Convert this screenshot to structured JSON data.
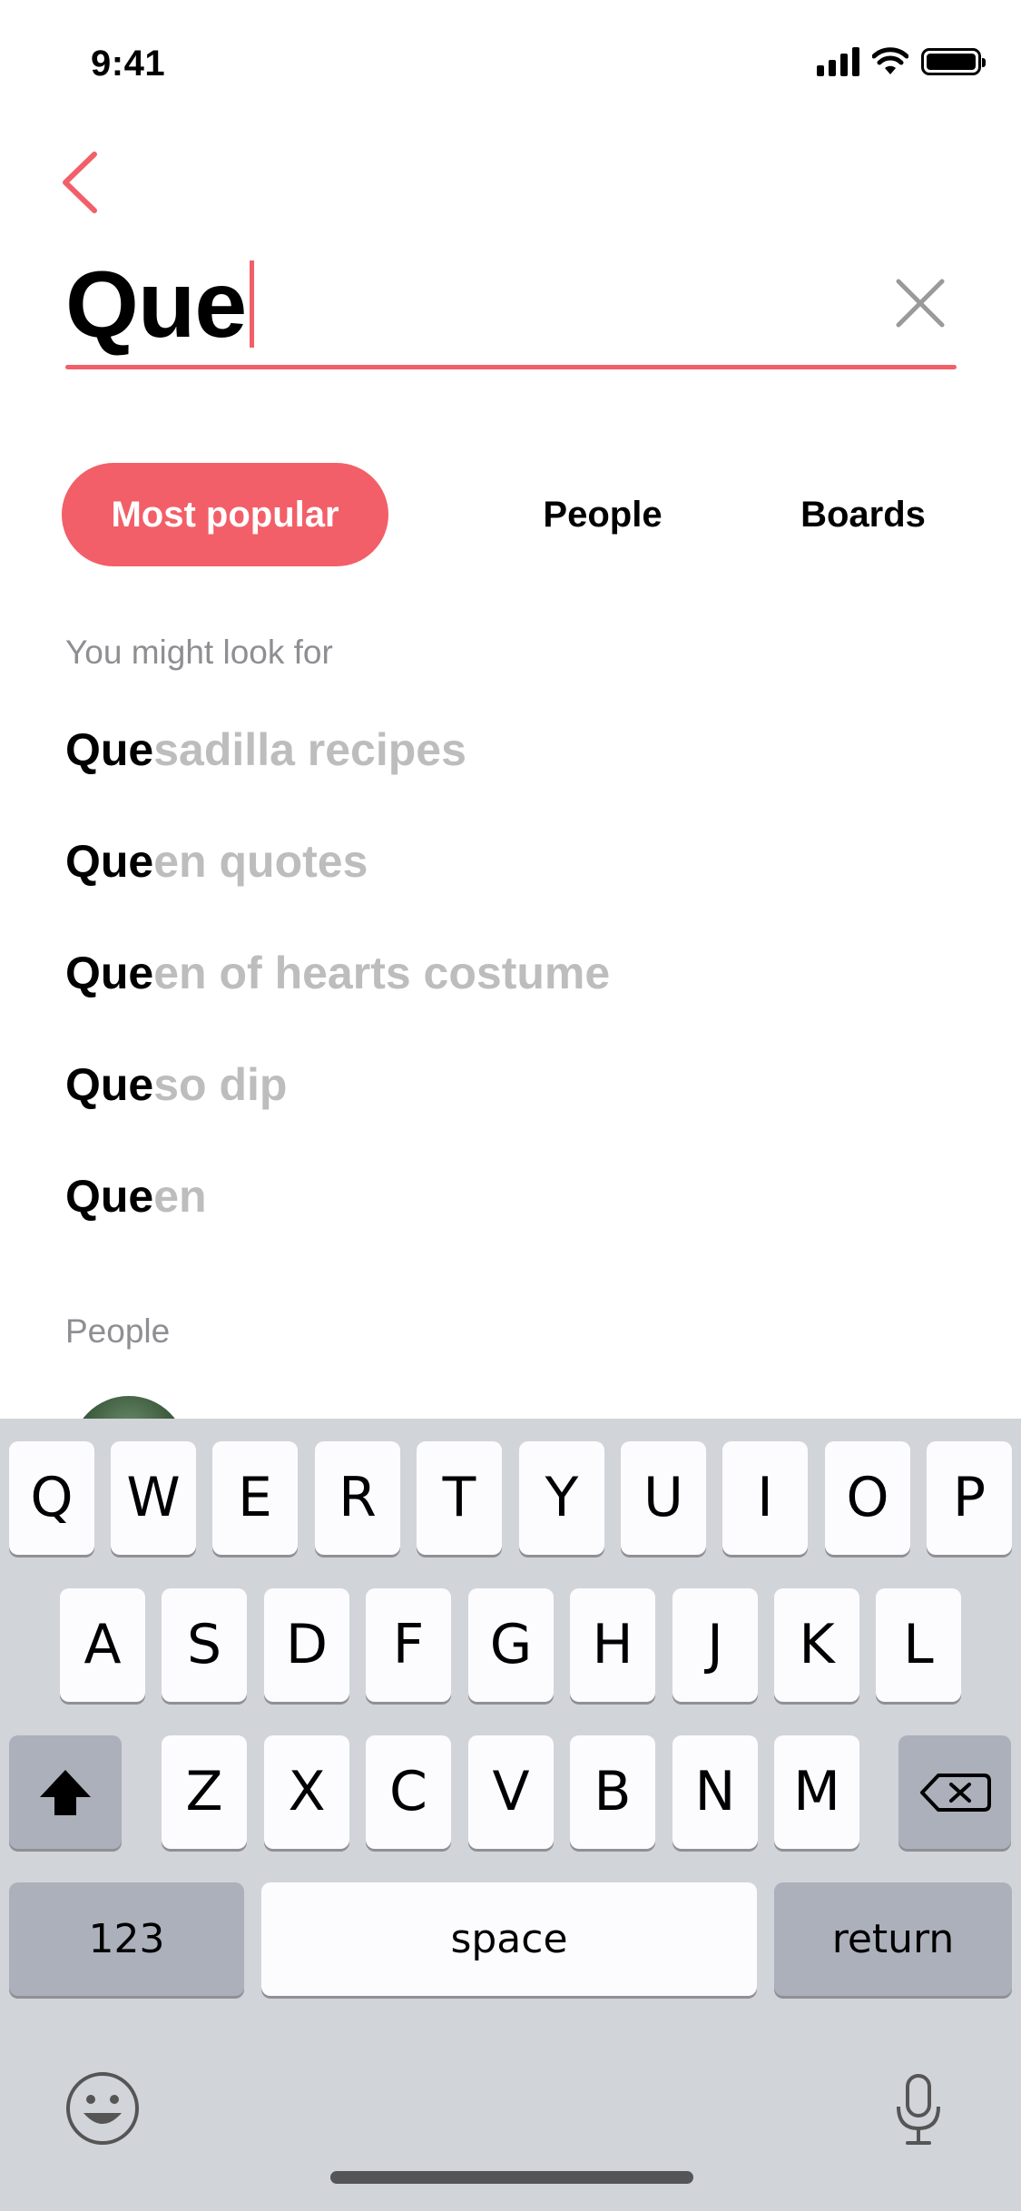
{
  "status_bar": {
    "time": "9:41"
  },
  "search": {
    "value": "Que"
  },
  "tabs": [
    {
      "label": "Most popular",
      "active": true
    },
    {
      "label": "People",
      "active": false
    },
    {
      "label": "Boards",
      "active": false
    }
  ],
  "sections": {
    "suggestions_label": "You might look for",
    "people_label": "People"
  },
  "suggestions": [
    {
      "typed": "Que",
      "rest": "sadilla recipes"
    },
    {
      "typed": "Que",
      "rest": "en quotes"
    },
    {
      "typed": "Que",
      "rest": "en of hearts costume"
    },
    {
      "typed": "Que",
      "rest": "so dip"
    },
    {
      "typed": "Que",
      "rest": "en"
    }
  ],
  "keyboard": {
    "row1": [
      "Q",
      "W",
      "E",
      "R",
      "T",
      "Y",
      "U",
      "I",
      "O",
      "P"
    ],
    "row2": [
      "A",
      "S",
      "D",
      "F",
      "G",
      "H",
      "J",
      "K",
      "L"
    ],
    "row3": [
      "Z",
      "X",
      "C",
      "V",
      "B",
      "N",
      "M"
    ],
    "numbers_label": "123",
    "space_label": "space",
    "return_label": "return"
  },
  "colors": {
    "accent": "#f25f68",
    "muted_text": "#bdbdbd",
    "keyboard_bg": "#d1d4d9"
  }
}
